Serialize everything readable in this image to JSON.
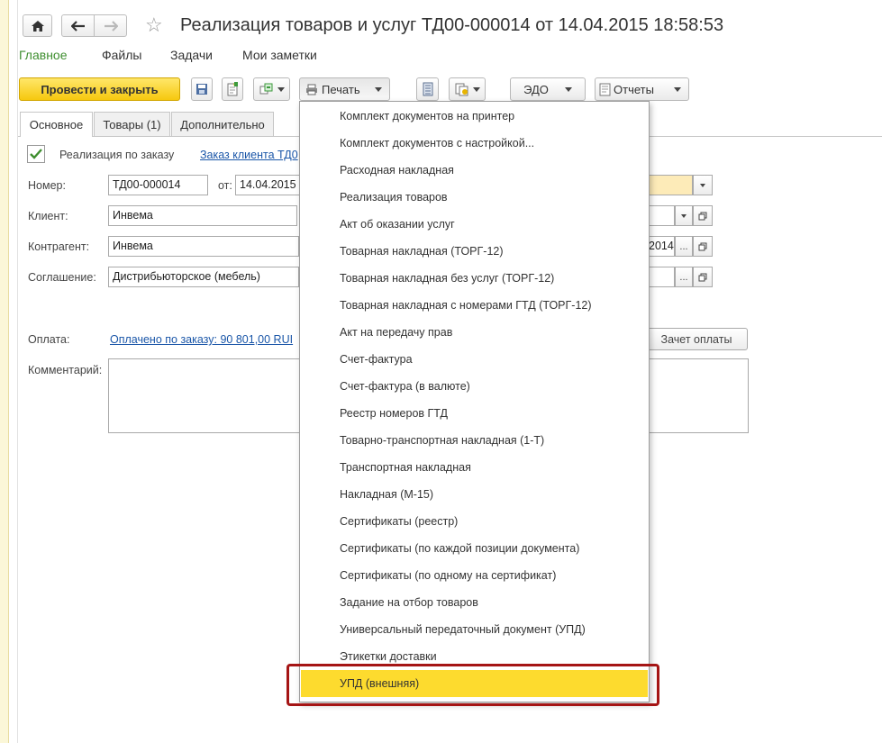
{
  "window": {
    "title": "Реализация товаров и услуг ТД00-000014 от 14.04.2015 18:58:53"
  },
  "nav": {
    "items": [
      "Главное",
      "Файлы",
      "Задачи",
      "Мои заметки"
    ]
  },
  "toolbar": {
    "post_close": "Провести и закрыть",
    "print": "Печать",
    "edo": "ЭДО",
    "reports": "Отчеты"
  },
  "tabs": [
    "Основное",
    "Товары (1)",
    "Дополнительно"
  ],
  "form": {
    "by_order_label": "Реализация по заказу",
    "by_order_checked": true,
    "order_link": "Заказ клиента ТД0",
    "number_label": "Номер:",
    "number_value": "ТД00-000014",
    "date_label": "от:",
    "date_value": "14.04.2015",
    "client_label": "Клиент:",
    "client_value": "Инвема",
    "counterparty_label": "Контрагент:",
    "counterparty_value": "Инвема",
    "contract_date_fragment": "2014",
    "agreement_label": "Соглашение:",
    "agreement_value": "Дистрибьюторское (мебель)",
    "payment_label": "Оплата:",
    "payment_link": "Оплачено по заказу: 90 801,00 RUI",
    "offset_button": "Зачет оплаты",
    "comment_label": "Комментарий:",
    "comment_value": ""
  },
  "print_menu": {
    "items": [
      "Комплект документов на принтер",
      "Комплект документов с настройкой...",
      "Расходная накладная",
      "Реализация товаров",
      "Акт об оказании услуг",
      "Товарная накладная (ТОРГ-12)",
      "Товарная накладная без услуг (ТОРГ-12)",
      "Товарная накладная с номерами ГТД (ТОРГ-12)",
      "Акт на передачу прав",
      "Счет-фактура",
      "Счет-фактура (в валюте)",
      "Реестр номеров ГТД",
      "Товарно-транспортная накладная (1-Т)",
      "Транспортная накладная",
      "Накладная (М-15)",
      "Сертификаты (реестр)",
      "Сертификаты (по каждой позиции документа)",
      "Сертификаты (по одному на сертификат)",
      "Задание на отбор товаров",
      "Универсальный передаточный документ (УПД)",
      "Этикетки доставки",
      "УПД (внешняя)"
    ],
    "highlighted_index": 21
  },
  "colors": {
    "accent_yellow": "#fddb2e",
    "link_blue": "#1a56a8",
    "nav_green": "#3e8e2f",
    "highlight_frame": "#a51515"
  }
}
